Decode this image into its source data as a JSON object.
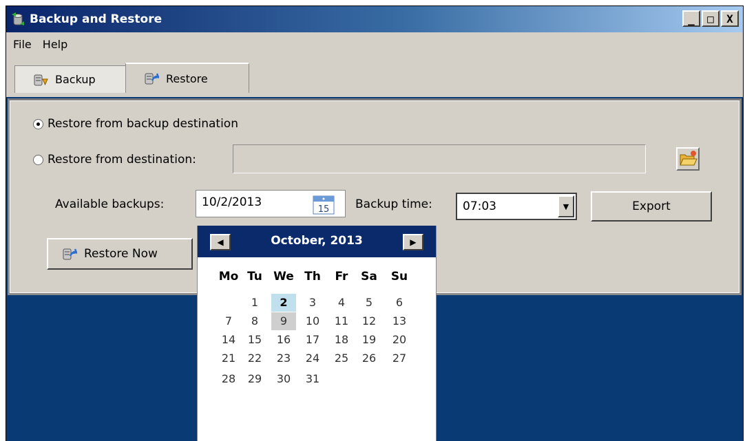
{
  "window": {
    "title": "Backup and Restore",
    "controls": [
      "_",
      "□",
      "X"
    ]
  },
  "menu": {
    "items": [
      "File",
      "Help"
    ]
  },
  "tabs": [
    {
      "label": "Backup",
      "icon": "backup-icon",
      "active": false
    },
    {
      "label": "Restore",
      "icon": "restore-icon",
      "active": true
    }
  ],
  "restore": {
    "option1_label": "Restore from backup destination",
    "option2_label": "Restore from destination:",
    "selected_option": 1,
    "destination_value": "",
    "available_label": "Available backups:",
    "available_value": "10/2/2013",
    "calendar_icon_number": "15",
    "time_label": "Backup time:",
    "time_value": "07:03",
    "export_label": "Export",
    "restore_now_label": "Restore Now"
  },
  "calendar": {
    "month_label": "October, 2013",
    "prev": "◀",
    "next": "▶",
    "weekdays": [
      "Mo",
      "Tu",
      "We",
      "Th",
      "Fr",
      "Sa",
      "Su"
    ],
    "selected_day": 2,
    "highlight_day": 9,
    "first_weekday_index": 1,
    "days_in_month": 31
  },
  "colors": {
    "title_bar_start": "#0a246a",
    "title_bar_end": "#a6caf0",
    "desktop": "#0a3a73",
    "face": "#d4d0c8",
    "calendar_header": "#0b2a6b",
    "selected_day": "#bfe0ec"
  }
}
